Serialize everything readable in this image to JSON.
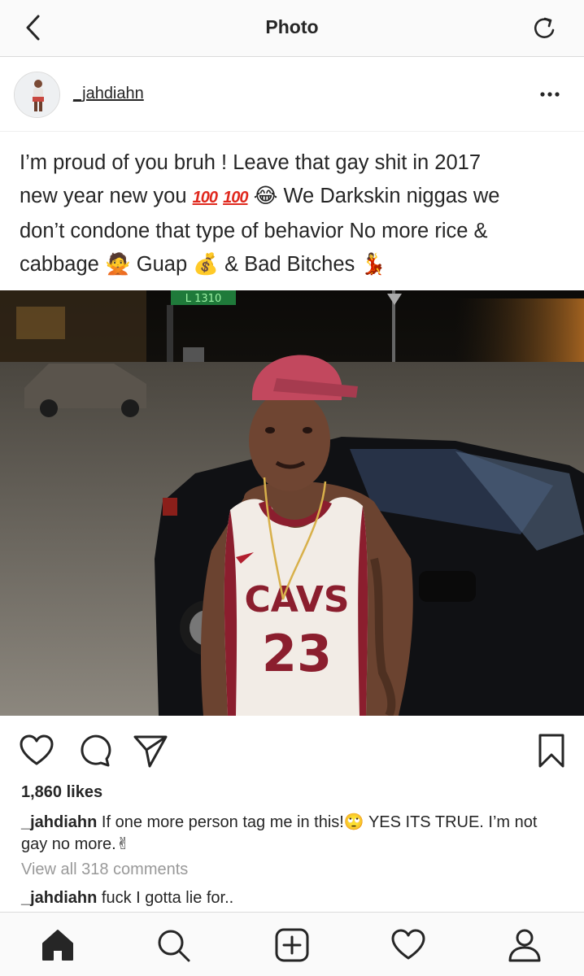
{
  "header": {
    "title": "Photo"
  },
  "post": {
    "username": "_jahdiahn",
    "caption": {
      "line1": "I’m proud of you bruh ! Leave that gay shit in 2017",
      "line2_before": "new year new you ",
      "hundred": "100",
      "line2_after": " We Darkskin niggas we",
      "line3": "don’t condone that type of behavior No more rice &",
      "line4_a": "cabbage ",
      "line4_b": " Guap ",
      "line4_c": " & Bad Bitches "
    },
    "likes": "1,860 likes",
    "comments": [
      {
        "user": "_jahdiahn",
        "text_a": " If one more person tag me in this!",
        "text_b": " YES ITS TRUE. I’m not gay no more."
      },
      {
        "user": "_jahdiahn",
        "text_a": " fuck I gotta lie for.."
      }
    ],
    "view_all": "View all 318 comments",
    "photo": {
      "jersey_team": "CAVS",
      "jersey_number": "23",
      "sign_text": "L 1310"
    }
  },
  "icons": {
    "back": "chevron-left-icon",
    "refresh": "refresh-icon",
    "more": "more-horizontal-icon",
    "like": "heart-icon",
    "comment": "comment-icon",
    "share": "paper-plane-icon",
    "save": "bookmark-icon",
    "home": "home-icon",
    "search": "search-icon",
    "add": "add-post-icon",
    "activity": "heart-icon",
    "profile": "profile-icon"
  },
  "colors": {
    "text": "#262626",
    "muted": "#999999",
    "border": "#dbdbdb"
  }
}
